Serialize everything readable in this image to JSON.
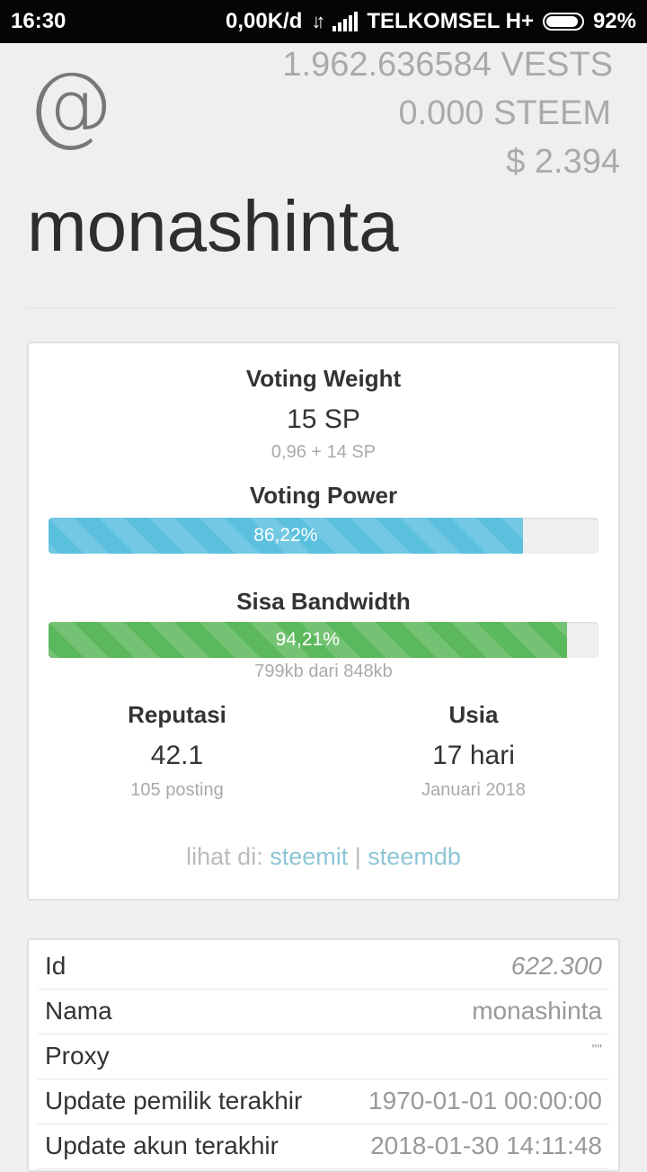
{
  "status_bar": {
    "time": "16:30",
    "speed": "0,00K/d",
    "carrier": "TELKOMSEL H+",
    "battery": "92%",
    "battery_level": 0.92
  },
  "header": {
    "at": "@",
    "vests": "1.962.636584 VESTS",
    "steem": "0.000 STEEM",
    "usd": "$ 2.394",
    "username": "monashinta"
  },
  "stats": {
    "voting_weight_label": "Voting Weight",
    "voting_weight_value": "15 SP",
    "voting_weight_detail": "0,96 + 14 SP",
    "voting_power_label": "Voting Power",
    "voting_power_text": "86,22%",
    "voting_power_fraction": 0.8622,
    "bandwidth_label": "Sisa Bandwidth",
    "bandwidth_text": "94,21%",
    "bandwidth_fraction": 0.9421,
    "bandwidth_detail": "799kb dari 848kb",
    "reputation_label": "Reputasi",
    "reputation_value": "42.1",
    "reputation_detail": "105 posting",
    "age_label": "Usia",
    "age_value": "17 hari",
    "age_detail": "Januari 2018",
    "links_prefix": "lihat di:",
    "link_steemit": "steemit",
    "link_sep": "|",
    "link_steemdb": "steemdb"
  },
  "details": [
    {
      "key": "Id",
      "value": "622.300"
    },
    {
      "key": "Nama",
      "value": "monashinta"
    },
    {
      "key": "Proxy",
      "value": "\"\""
    },
    {
      "key": "Update pemilik terakhir",
      "value": "1970-01-01 00:00:00"
    },
    {
      "key": "Update akun terakhir",
      "value": "2018-01-30 14:11:48"
    }
  ],
  "colors": {
    "voting_power_bar": "#5bc0de",
    "bandwidth_bar": "#5cb85c",
    "link": "#8ec5d6"
  }
}
